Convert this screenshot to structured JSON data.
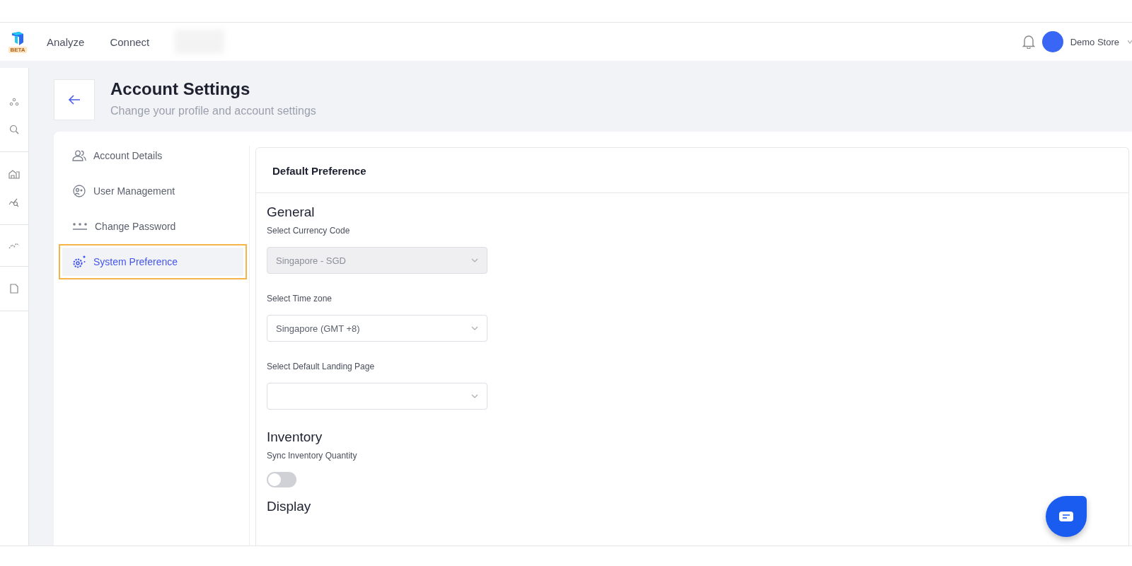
{
  "topbar": {
    "logo_badge": "BETA",
    "nav": [
      "Analyze",
      "Connect"
    ],
    "user": "Demo Store"
  },
  "header": {
    "title": "Account Settings",
    "subtitle": "Change your profile and account settings"
  },
  "settings_nav": [
    {
      "label": "Account Details",
      "selected": false
    },
    {
      "label": "User Management",
      "selected": false
    },
    {
      "label": "Change Password",
      "selected": false
    },
    {
      "label": "System Preference",
      "selected": true
    }
  ],
  "panel": {
    "title": "Default Preference",
    "sections": [
      {
        "heading": "General",
        "items": [
          {
            "kind": "select",
            "label": "Select Currency Code",
            "value": "Singapore - SGD",
            "disabled": true
          },
          {
            "kind": "select",
            "label": "Select Time zone",
            "value": "Singapore (GMT +8)",
            "disabled": false
          },
          {
            "kind": "select",
            "label": "Select Default Landing Page",
            "disabled": false
          }
        ]
      },
      {
        "heading": "Inventory",
        "items": [
          {
            "kind": "toggle",
            "label": "Sync Inventory Quantity",
            "on": false
          }
        ]
      },
      {
        "heading": "Display"
      }
    ]
  }
}
